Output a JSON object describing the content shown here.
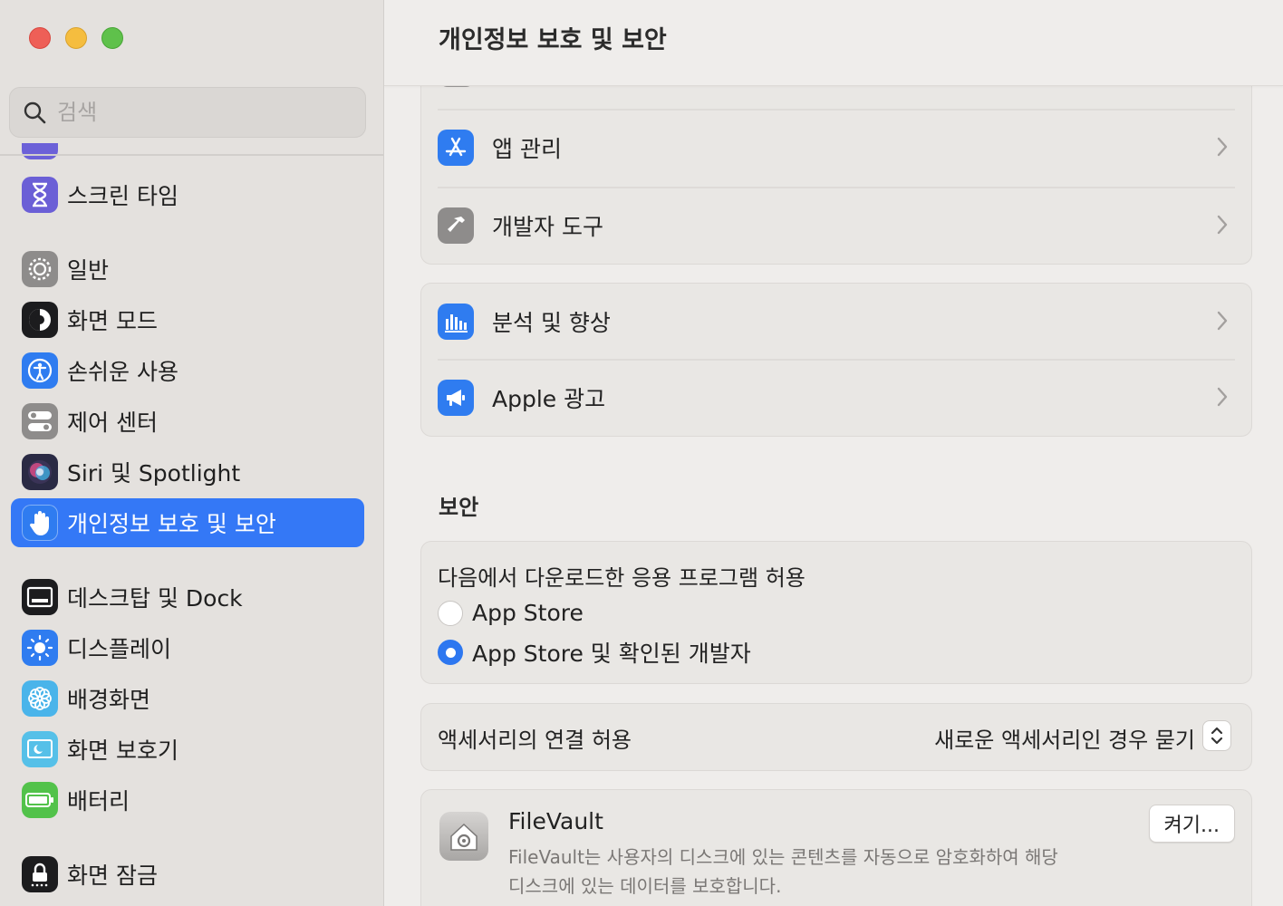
{
  "sidebar": {
    "search": {
      "placeholder": "검색",
      "value": ""
    },
    "items": [
      {
        "label": "스크린 타임",
        "icon": "hourglass-icon",
        "color": "#6b5fd6"
      },
      {
        "label": "일반",
        "icon": "gear-icon",
        "color": "#8e8c8b"
      },
      {
        "label": "화면 모드",
        "icon": "appearance-icon",
        "color": "#1c1c1e"
      },
      {
        "label": "손쉬운 사용",
        "icon": "accessibility-icon",
        "color": "#2f7cf0"
      },
      {
        "label": "제어 센터",
        "icon": "toggles-icon",
        "color": "#8e8c8b"
      },
      {
        "label": "Siri 및 Spotlight",
        "icon": "siri-icon",
        "color": "#2a2a44"
      },
      {
        "label": "개인정보 보호 및 보안",
        "icon": "hand-icon",
        "color": "#2f7cf0",
        "active": true
      },
      {
        "label": "데스크탑 및 Dock",
        "icon": "dock-icon",
        "color": "#1c1c1e"
      },
      {
        "label": "디스플레이",
        "icon": "sun-icon",
        "color": "#2f7cf0"
      },
      {
        "label": "배경화면",
        "icon": "flower-icon",
        "color": "#4ab4ea"
      },
      {
        "label": "화면 보호기",
        "icon": "screensaver-icon",
        "color": "#56c0e8"
      },
      {
        "label": "배터리",
        "icon": "battery-icon",
        "color": "#52c24a"
      },
      {
        "label": "화면 잠금",
        "icon": "lock-icon",
        "color": "#1c1c1e"
      }
    ]
  },
  "main": {
    "title": "개인정보 보호 및 보안",
    "group1": [
      {
        "label": "앱 관리",
        "icon": "app-store-icon",
        "color": "#2f7cf0"
      },
      {
        "label": "개발자 도구",
        "icon": "hammer-icon",
        "color": "#8e8c8b"
      }
    ],
    "group2": [
      {
        "label": "분석 및 향상",
        "icon": "bar-chart-icon",
        "color": "#2f7cf0"
      },
      {
        "label": "Apple 광고",
        "icon": "megaphone-icon",
        "color": "#2f7cf0"
      }
    ],
    "security": {
      "section_title": "보안",
      "download_title": "다음에서 다운로드한 응용 프로그램 허용",
      "options": [
        {
          "label": "App Store",
          "selected": false
        },
        {
          "label": "App Store 및 확인된 개발자",
          "selected": true
        }
      ],
      "accessory_label": "액세서리의 연결 허용",
      "accessory_value": "새로운 액세서리인 경우 묻기",
      "filevault": {
        "title": "FileVault",
        "description_line1": "FileVault는 사용자의 디스크에 있는 콘텐츠를 자동으로 암호화하여 해당",
        "description_line2": "디스크에 있는 데이터를 보호합니다.",
        "button": "켜기..."
      }
    }
  }
}
